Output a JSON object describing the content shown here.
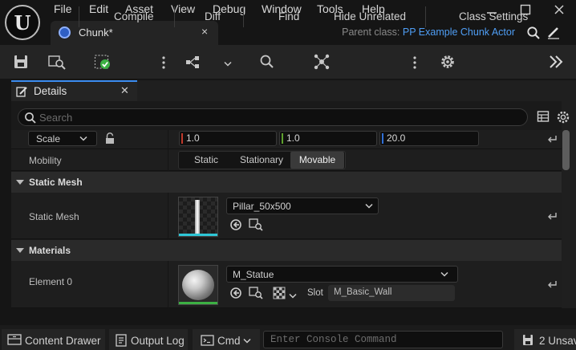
{
  "menu": [
    "File",
    "Edit",
    "Asset",
    "View",
    "Debug",
    "Window",
    "Tools",
    "Help"
  ],
  "tab": {
    "title": "Chunk*",
    "close": "×"
  },
  "parent_class": {
    "label": "Parent class:",
    "value": "PP Example Chunk Actor"
  },
  "toolbar": {
    "compile": "Compile",
    "diff": "Diff",
    "find": "Find",
    "hide_unrelated": "Hide Unrelated",
    "class_settings": "Class Settings"
  },
  "details": {
    "tab_label": "Details",
    "search_placeholder": "Search",
    "scale": {
      "mode": "Scale",
      "x": "1.0",
      "y": "1.0",
      "z": "20.0"
    },
    "mobility": {
      "label": "Mobility",
      "options": [
        "Static",
        "Stationary",
        "Movable"
      ],
      "selected": "Movable"
    },
    "static_mesh_section": {
      "title": "Static Mesh",
      "label": "Static Mesh",
      "asset": "Pillar_50x500"
    },
    "materials_section": {
      "title": "Materials",
      "element_label": "Element 0",
      "asset": "M_Statue",
      "slot_label": "Slot",
      "slot_value": "M_Basic_Wall"
    }
  },
  "statusbar": {
    "content_drawer": "Content Drawer",
    "output_log": "Output Log",
    "cmd": "Cmd",
    "console_placeholder": "Enter Console Command",
    "unsaved": "2 Unsav"
  },
  "colors": {
    "accent": "#3b8cf0",
    "link": "#4f9ef5",
    "green": "#3cb043",
    "cyan": "#2ec6d6",
    "x_axis": "#c0392b",
    "y_axis": "#5ea02d",
    "z_axis": "#2f6fd6"
  },
  "icons": [
    "unreal-logo-icon",
    "minimize-icon",
    "maximize-icon",
    "close-icon",
    "blueprint-icon",
    "search-icon",
    "pencil-icon",
    "save-icon",
    "browse-icon",
    "compile-icon",
    "diff-icon",
    "find-icon",
    "hide-unrelated-icon",
    "gear-icon",
    "chevron-right-double-icon",
    "table-icon",
    "lock-icon",
    "reset-arrow-icon",
    "use-selected-icon",
    "browse-asset-icon",
    "checker-icon",
    "drawer-icon",
    "log-icon",
    "terminal-icon",
    "save-all-icon"
  ]
}
